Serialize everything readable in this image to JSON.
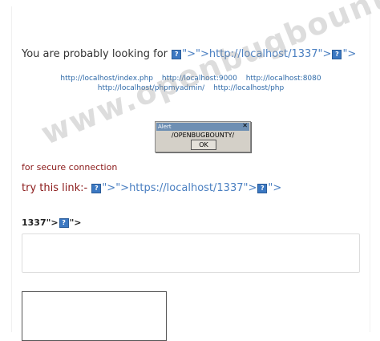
{
  "headline": {
    "prefix": "You are probably looking for",
    "payload_a": "\">\">http://localhost/1337\">",
    "payload_b": "\">"
  },
  "links": {
    "row1": [
      "http://localhost/index.php",
      "http://localhost:9000",
      "http://localhost:8080"
    ],
    "row2": [
      "http://localhost/phpmyadmin/",
      "http://localhost/php"
    ]
  },
  "alert": {
    "title": "Alert",
    "close": "✕",
    "message": "/OPENBUGBOUNTY/",
    "ok": "OK"
  },
  "secure_text": "for secure connection",
  "try_link": {
    "prefix": "try this link:-",
    "payload_a": "\">\">https://localhost/1337\">",
    "payload_b": "\">"
  },
  "label1337": {
    "prefix": "1337\">",
    "suffix": "\">"
  },
  "icon_glyph": "?",
  "watermark": "www.openbugbounty.org",
  "colors": {
    "link": "#2f6aa8",
    "accent_red": "#8b1a1a",
    "icon_blue": "#3b78c2"
  }
}
